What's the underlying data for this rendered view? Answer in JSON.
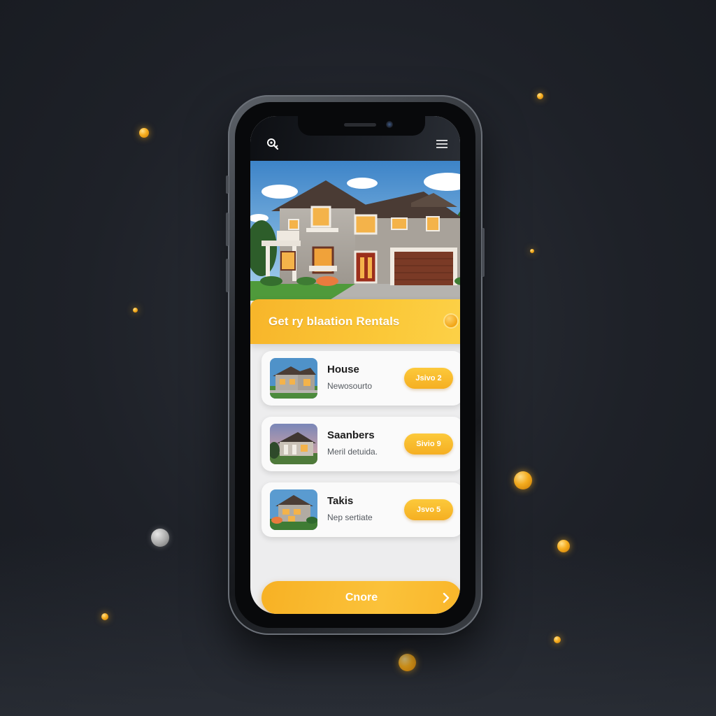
{
  "app": {
    "banner_title": "Get ry blaation Rentals"
  },
  "header": {
    "left_icon": "search-key-icon",
    "right_icon": "hamburger-menu-icon"
  },
  "listings": [
    {
      "title": "House",
      "subtitle": "Newosourto",
      "button_label": "Jsivo 2"
    },
    {
      "title": "Saanbers",
      "subtitle": "Meril detuida.",
      "button_label": "Sivio 9"
    },
    {
      "title": "Takis",
      "subtitle": "Nep sertiate",
      "button_label": "Jsvo 5"
    }
  ],
  "cta": {
    "label": "Cnore",
    "icon": "chevron-right-icon"
  },
  "colors": {
    "accent": "#f7b52a",
    "background": "#1e2128",
    "screen": "#ededee"
  }
}
